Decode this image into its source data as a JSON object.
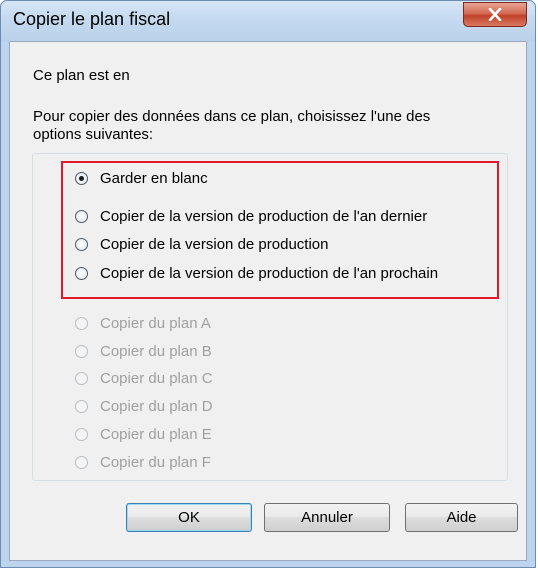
{
  "window": {
    "title": "Copier le plan fiscal"
  },
  "intro": {
    "line1": "Ce plan est en",
    "line2": "Pour copier des données dans ce plan, choisissez l'une des",
    "line3": "options suivantes:"
  },
  "options": [
    {
      "label": "Garder en blanc",
      "checked": true,
      "enabled": true
    },
    {
      "label": "Copier de la version de production de l'an dernier",
      "checked": false,
      "enabled": true
    },
    {
      "label": "Copier de la version de production",
      "checked": false,
      "enabled": true
    },
    {
      "label": "Copier de la version de production de l'an prochain",
      "checked": false,
      "enabled": true
    },
    {
      "label": "Copier du plan A",
      "checked": false,
      "enabled": false
    },
    {
      "label": "Copier du plan B",
      "checked": false,
      "enabled": false
    },
    {
      "label": "Copier du plan C",
      "checked": false,
      "enabled": false
    },
    {
      "label": "Copier du plan D",
      "checked": false,
      "enabled": false
    },
    {
      "label": "Copier du plan E",
      "checked": false,
      "enabled": false
    },
    {
      "label": "Copier du plan F",
      "checked": false,
      "enabled": false
    }
  ],
  "buttons": {
    "ok": "OK",
    "cancel": "Annuler",
    "help": "Aide"
  },
  "colors": {
    "highlight": "#e0192b",
    "close_button": "#c0412a",
    "disabled_text": "#a0a0a0"
  }
}
